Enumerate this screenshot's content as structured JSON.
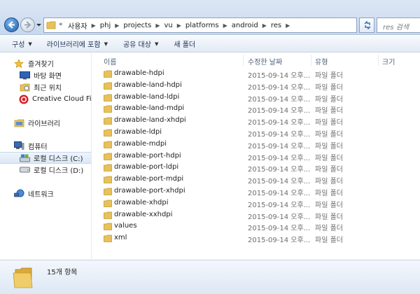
{
  "address": {
    "prefix": "«",
    "crumbs": [
      "사용자",
      "phj",
      "projects",
      "vu",
      "platforms",
      "android",
      "res"
    ]
  },
  "search": {
    "placeholder": "res 검색"
  },
  "toolbar": {
    "organize": "구성",
    "include_library": "라이브러리에 포함",
    "share": "공유 대상",
    "new_folder": "새 폴더"
  },
  "nav": {
    "favorites": "즐겨찾기",
    "desktop": "바탕 화면",
    "recent": "최근 위치",
    "creative_cloud": "Creative Cloud Files",
    "libraries": "라이브러리",
    "computer": "컴퓨터",
    "drive_c": "로컬 디스크 (C:)",
    "drive_d": "로컬 디스크 (D:)",
    "network": "네트워크"
  },
  "columns": {
    "name": "이름",
    "date": "수정한 날짜",
    "type": "유형",
    "size": "크기"
  },
  "files": [
    {
      "name": "drawable-hdpi",
      "date": "2015-09-14 오후...",
      "type": "파일 폴더"
    },
    {
      "name": "drawable-land-hdpi",
      "date": "2015-09-14 오후...",
      "type": "파일 폴더"
    },
    {
      "name": "drawable-land-ldpi",
      "date": "2015-09-14 오후...",
      "type": "파일 폴더"
    },
    {
      "name": "drawable-land-mdpi",
      "date": "2015-09-14 오후...",
      "type": "파일 폴더"
    },
    {
      "name": "drawable-land-xhdpi",
      "date": "2015-09-14 오후...",
      "type": "파일 폴더"
    },
    {
      "name": "drawable-ldpi",
      "date": "2015-09-14 오후...",
      "type": "파일 폴더"
    },
    {
      "name": "drawable-mdpi",
      "date": "2015-09-14 오후...",
      "type": "파일 폴더"
    },
    {
      "name": "drawable-port-hdpi",
      "date": "2015-09-14 오후...",
      "type": "파일 폴더"
    },
    {
      "name": "drawable-port-ldpi",
      "date": "2015-09-14 오후...",
      "type": "파일 폴더"
    },
    {
      "name": "drawable-port-mdpi",
      "date": "2015-09-14 오후...",
      "type": "파일 폴더"
    },
    {
      "name": "drawable-port-xhdpi",
      "date": "2015-09-14 오후...",
      "type": "파일 폴더"
    },
    {
      "name": "drawable-xhdpi",
      "date": "2015-09-14 오후...",
      "type": "파일 폴더"
    },
    {
      "name": "drawable-xxhdpi",
      "date": "2015-09-14 오후...",
      "type": "파일 폴더"
    },
    {
      "name": "values",
      "date": "2015-09-14 오후...",
      "type": "파일 폴더"
    },
    {
      "name": "xml",
      "date": "2015-09-14 오후...",
      "type": "파일 폴더"
    }
  ],
  "status": {
    "count": "15개 항목"
  },
  "colors": {
    "folder": "#e8c15a",
    "accent": "#1f5fa8",
    "chrome": "#dbe7f5"
  }
}
